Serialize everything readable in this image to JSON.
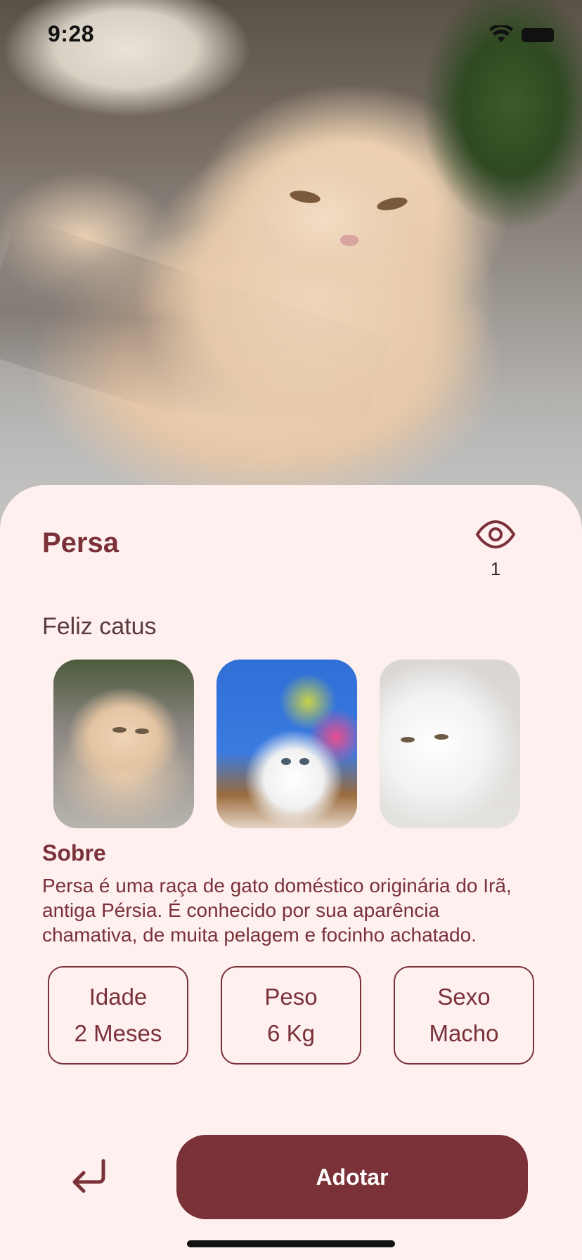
{
  "status_bar": {
    "time": "9:28"
  },
  "pet": {
    "name": "Persa",
    "views_count": "1",
    "subtitle": "Feliz catus",
    "gallery": [
      {
        "icon": "cat-photo-1"
      },
      {
        "icon": "cat-photo-2"
      },
      {
        "icon": "cat-photo-3"
      }
    ],
    "about_title": "Sobre",
    "about_text": "Persa é uma raça de gato doméstico originária do Irã, antiga Pérsia. É conhecido por sua aparência chamativa, de muita pelagem e focinho achatado.",
    "stats": [
      {
        "label": "Idade",
        "value": "2 Meses"
      },
      {
        "label": "Peso",
        "value": "6 Kg"
      },
      {
        "label": "Sexo",
        "value": "Macho"
      }
    ]
  },
  "actions": {
    "adopt_label": "Adotar",
    "back_icon": "return-arrow-icon"
  },
  "colors": {
    "primary": "#7a3138",
    "background": "#fff0f0",
    "text_dark": "#3b2224"
  }
}
